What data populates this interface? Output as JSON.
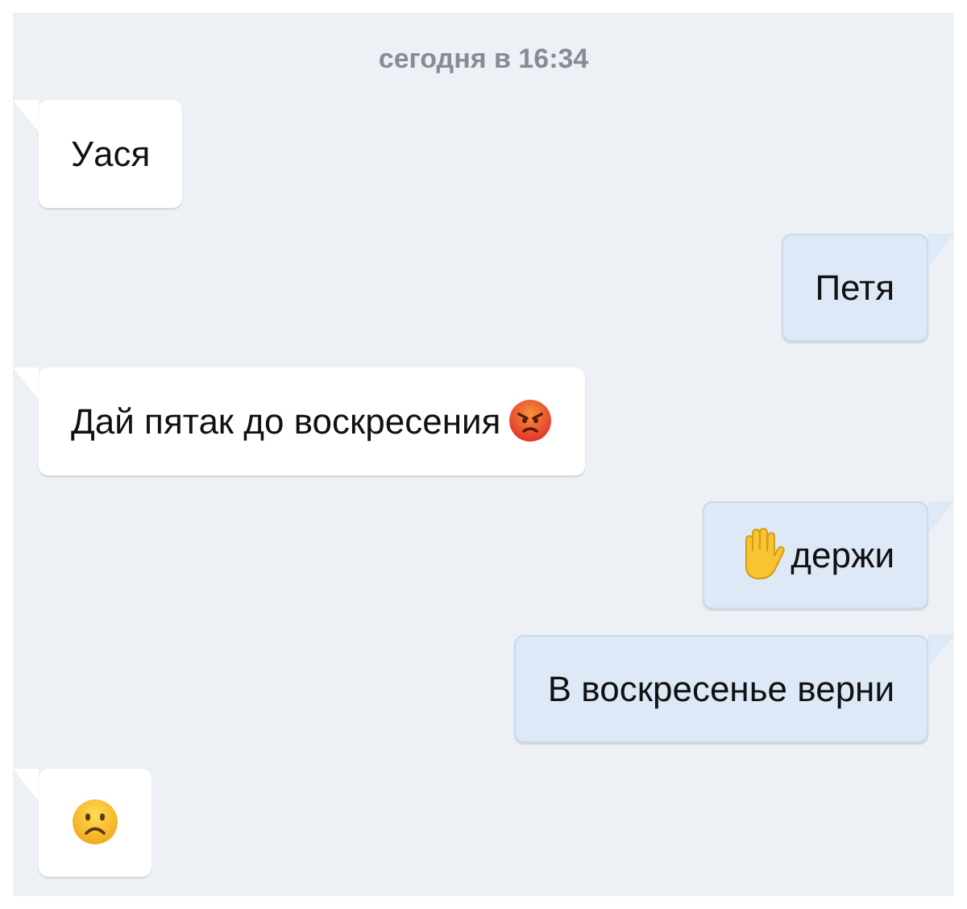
{
  "timestamp": "сегодня в 16:34",
  "messages": [
    {
      "kind": "incoming",
      "parts": [
        {
          "kind": "text",
          "text": "Уася"
        }
      ]
    },
    {
      "kind": "outgoing",
      "parts": [
        {
          "kind": "text",
          "text": "Петя"
        }
      ]
    },
    {
      "kind": "incoming",
      "parts": [
        {
          "kind": "text",
          "text": "Дай пятак до воскресения"
        },
        {
          "kind": "angry"
        }
      ]
    },
    {
      "kind": "outgoing",
      "parts": [
        {
          "kind": "hand"
        },
        {
          "kind": "text",
          "text": "держи"
        }
      ]
    },
    {
      "kind": "outgoing",
      "parts": [
        {
          "kind": "text",
          "text": "В воскресенье верни"
        }
      ]
    },
    {
      "kind": "incoming",
      "parts": [
        {
          "kind": "frown"
        }
      ]
    }
  ]
}
